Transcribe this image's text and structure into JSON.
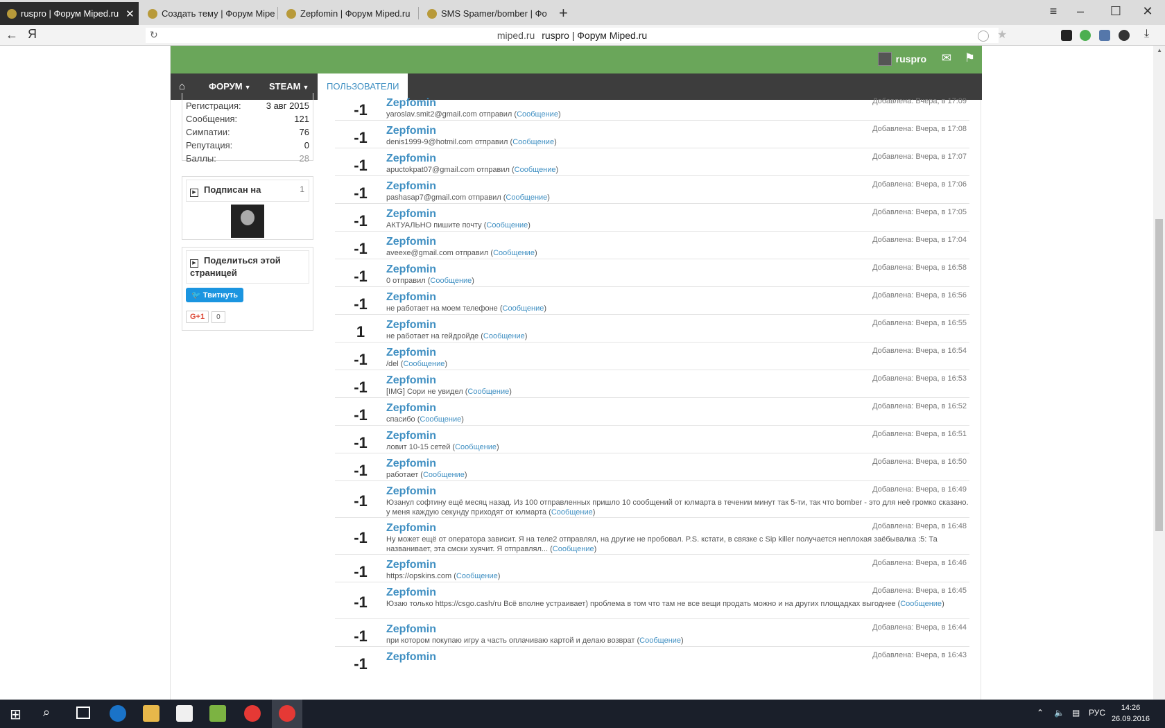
{
  "browser": {
    "tabs": [
      {
        "title": "ruspro | Форум Miped.ru",
        "active": true
      },
      {
        "title": "Создать тему | Форум Mipe",
        "active": false
      },
      {
        "title": "Zepfomin | Форум Miped.ru",
        "active": false
      },
      {
        "title": "SMS Spamer/bomber | Фо",
        "active": false
      }
    ],
    "address": {
      "domain": "miped.ru",
      "title": "ruspro | Форум Miped.ru"
    }
  },
  "header": {
    "username": "ruspro"
  },
  "nav": {
    "forum": "ФОРУМ",
    "steam": "STEAM",
    "users": "ПОЛЬЗОВАТЕЛИ"
  },
  "profile_stats": [
    {
      "label": "Регистрация:",
      "value": "3 авг 2015"
    },
    {
      "label": "Сообщения:",
      "value": "121"
    },
    {
      "label": "Симпатии:",
      "value": "76"
    },
    {
      "label": "Репутация:",
      "value": "0"
    },
    {
      "label": "Баллы:",
      "value": "28"
    }
  ],
  "following": {
    "title": "Подписан на",
    "count": "1"
  },
  "share": {
    "title": "Поделиться этой страницей",
    "tweet": "Твитнуть",
    "gplus": "G+1",
    "gplus_count": "0"
  },
  "reputation": [
    {
      "score": "-1",
      "user": "Zepfomin",
      "text": "yaroslav.smit2@gmail.com отправил",
      "link": "Сообщение",
      "date": "Добавлена: Вчера, в 17:09"
    },
    {
      "score": "-1",
      "user": "Zepfomin",
      "text": "denis1999-9@hotmil.com отправил",
      "link": "Сообщение",
      "date": "Добавлена: Вчера, в 17:08"
    },
    {
      "score": "-1",
      "user": "Zepfomin",
      "text": "apuctokpat07@gmail.com отправил",
      "link": "Сообщение",
      "date": "Добавлена: Вчера, в 17:07"
    },
    {
      "score": "-1",
      "user": "Zepfomin",
      "text": "pashasap7@gmail.com отправил",
      "link": "Сообщение",
      "date": "Добавлена: Вчера, в 17:06"
    },
    {
      "score": "-1",
      "user": "Zepfomin",
      "text": "АКТУАЛЬНО пишите почту",
      "link": "Сообщение",
      "date": "Добавлена: Вчера, в 17:05"
    },
    {
      "score": "-1",
      "user": "Zepfomin",
      "text": "aveexe@gmail.com отправил",
      "link": "Сообщение",
      "date": "Добавлена: Вчера, в 17:04"
    },
    {
      "score": "-1",
      "user": "Zepfomin",
      "text": "0 отправил",
      "link": "Сообщение",
      "date": "Добавлена: Вчера, в 16:58"
    },
    {
      "score": "-1",
      "user": "Zepfomin",
      "text": "не работает на моем телефоне",
      "link": "Сообщение",
      "date": "Добавлена: Вчера, в 16:56"
    },
    {
      "score": "1",
      "user": "Zepfomin",
      "text": "не работает на гейдройде",
      "link": "Сообщение",
      "date": "Добавлена: Вчера, в 16:55"
    },
    {
      "score": "-1",
      "user": "Zepfomin",
      "text": "/del",
      "link": "Сообщение",
      "date": "Добавлена: Вчера, в 16:54"
    },
    {
      "score": "-1",
      "user": "Zepfomin",
      "text": "[IMG] Сори не увидел",
      "link": "Сообщение",
      "date": "Добавлена: Вчера, в 16:53"
    },
    {
      "score": "-1",
      "user": "Zepfomin",
      "text": "спасибо",
      "link": "Сообщение",
      "date": "Добавлена: Вчера, в 16:52"
    },
    {
      "score": "-1",
      "user": "Zepfomin",
      "text": "ловит 10-15 сетей",
      "link": "Сообщение",
      "date": "Добавлена: Вчера, в 16:51"
    },
    {
      "score": "-1",
      "user": "Zepfomin",
      "text": "работает",
      "link": "Сообщение",
      "date": "Добавлена: Вчера, в 16:50"
    },
    {
      "score": "-1",
      "user": "Zepfomin",
      "text": "Юзанул софтину ещё месяц назад. Из 100 отправленных пришло 10 сообщений от юлмарта в течении минут так 5-ти, так что bomber - это для неё громко сказано. у меня каждую секунду приходят от юлмарта",
      "link": "Сообщение",
      "date": "Добавлена: Вчера, в 16:49"
    },
    {
      "score": "-1",
      "user": "Zepfomin",
      "text": "Ну может ещё от оператора зависит. Я на теле2 отправлял, на другие не пробовал. P.S. кстати, в связке с Sip killer получается неплохая заёбывалка :5: Та названивает, эта смски хуячит. Я отправлял...",
      "link": "Сообщение",
      "date": "Добавлена: Вчера, в 16:48"
    },
    {
      "score": "-1",
      "user": "Zepfomin",
      "text": "https://opskins.com",
      "link": "Сообщение",
      "date": "Добавлена: Вчера, в 16:46"
    },
    {
      "score": "-1",
      "user": "Zepfomin",
      "text": "Юзаю только https://csgo.cash/ru Всё вполне устраивает) проблема в том что там не все вещи продать можно и на других площадках выгоднее",
      "link": "Сообщение",
      "date": "Добавлена: Вчера, в 16:45"
    },
    {
      "score": "-1",
      "user": "Zepfomin",
      "text": "при котором покупаю игру а часть оплачиваю картой и делаю возврат",
      "link": "Сообщение",
      "date": "Добавлена: Вчера, в 16:44"
    },
    {
      "score": "-1",
      "user": "Zepfomin",
      "text": "",
      "link": "",
      "date": "Добавлена: Вчера, в 16:43"
    }
  ],
  "taskbar": {
    "lang": "РУС",
    "time": "14:26",
    "date": "26.09.2016"
  }
}
